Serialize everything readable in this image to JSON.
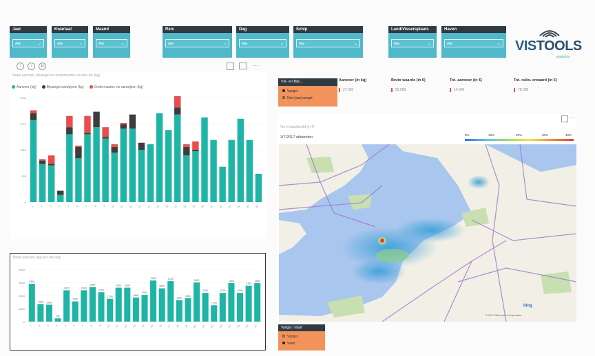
{
  "slicers": [
    {
      "id": "jaar",
      "label": "Jaar",
      "value": "Alle"
    },
    {
      "id": "kwartaal",
      "label": "Kwartaal",
      "value": "Alle"
    },
    {
      "id": "maand",
      "label": "Maand",
      "value": "Alle"
    },
    {
      "id": "reis",
      "label": "Reis",
      "value": "Alle"
    },
    {
      "id": "dag",
      "label": "Dag",
      "value": "Alle"
    },
    {
      "id": "schip",
      "label": "Schip",
      "value": "Alle"
    },
    {
      "id": "landvisser",
      "label": "Land/Vissersplaats",
      "value": "Alle"
    },
    {
      "id": "haven",
      "label": "Haven",
      "value": "Alle"
    }
  ],
  "logo": {
    "part1": "VIS",
    "part2": "TOOLS",
    "sub": "analytics"
  },
  "top_chart": {
    "title": "Totale aanvoer, bijvangst en ondermaatse vis per reis (kg)",
    "legend": [
      "Aanvoer (kg)",
      "Bijvangst aanwijzen (kg)",
      "Ondermaatse vis aanwijzen (kg)"
    ]
  },
  "bottom_chart": {
    "title": "Totale aanvoer (kg) per reis (kg)"
  },
  "selection_card": {
    "title": "Vis- en Bijv...",
    "items": [
      "Vangst",
      "Niet (aan)vangst"
    ]
  },
  "kpis": [
    {
      "label": "Aanvoer (in kg)",
      "value": "27.003"
    },
    {
      "label": "Bruto waarde (in €)",
      "value": "50.059"
    },
    {
      "label": "Tot. aanvoer (in €)",
      "value": "14.096"
    },
    {
      "label": "Tot. ruilw. erwaard (in €)",
      "value": "78.098"
    }
  ],
  "map": {
    "title": "Vis in kaartbeeld (in €)",
    "subtitle": "3/7/2017 afstanden",
    "legend_ticks": [
      "0%",
      "10%",
      "20%",
      "30%",
      "40%"
    ],
    "credit": "© 2017 Microsoft Corporation",
    "bing": "bing"
  },
  "bottom_filter": {
    "title": "Vangst / Vaart",
    "items": [
      "Vangst",
      "Vaart"
    ]
  },
  "colors": {
    "teal": "#1fb5a6",
    "dark": "#3d3d3d",
    "red": "#e94c4c",
    "sea": "#a9c6ee",
    "land": "#f1efe6"
  },
  "chart_data": [
    {
      "type": "bar",
      "stacked": true,
      "categories": [
        "1",
        "2",
        "3",
        "4",
        "5",
        "6",
        "7",
        "8",
        "9",
        "10",
        "11",
        "12",
        "13",
        "14",
        "15",
        "16",
        "17",
        "18",
        "19",
        "20",
        "21",
        "22",
        "23",
        "24",
        "25",
        "26"
      ],
      "series": [
        {
          "name": "Aanvoer (kg)",
          "values": [
            2900,
            1350,
            1300,
            250,
            2400,
            1550,
            2400,
            2650,
            2250,
            1750,
            2600,
            2600,
            1850,
            2050,
            3150,
            2550,
            3100,
            1650,
            1800,
            3000,
            2200,
            1250,
            2200,
            2950,
            2200,
            1000
          ]
        },
        {
          "name": "Bijvangst aanwijzen (kg)",
          "values": [
            250,
            120,
            50,
            150,
            250,
            400,
            50,
            550,
            50,
            200,
            150,
            500,
            250,
            0,
            0,
            0,
            250,
            300,
            50,
            0,
            0,
            0,
            0,
            0,
            0,
            0
          ]
        },
        {
          "name": "Ondermaatse vis aanwijzen (kg)",
          "values": [
            100,
            50,
            300,
            0,
            400,
            50,
            600,
            0,
            350,
            100,
            50,
            0,
            0,
            0,
            0,
            0,
            400,
            100,
            300,
            0,
            0,
            0,
            0,
            0,
            0,
            0
          ]
        }
      ],
      "ylim": [
        0,
        3700
      ]
    },
    {
      "type": "bar",
      "categories": [
        "1",
        "2",
        "3",
        "4",
        "5",
        "6",
        "7",
        "8",
        "9",
        "10",
        "11",
        "12",
        "13",
        "14",
        "15",
        "16",
        "17",
        "18",
        "19",
        "20",
        "21",
        "22",
        "23",
        "24",
        "25",
        "26",
        "27"
      ],
      "values": [
        2900,
        1350,
        1300,
        250,
        2400,
        1550,
        2400,
        2650,
        2250,
        1750,
        2600,
        2600,
        1850,
        2050,
        3150,
        2550,
        3100,
        1650,
        1800,
        3000,
        2200,
        1250,
        2200,
        2950,
        2200,
        2750,
        2950
      ],
      "ylim": [
        0,
        4000
      ]
    }
  ]
}
